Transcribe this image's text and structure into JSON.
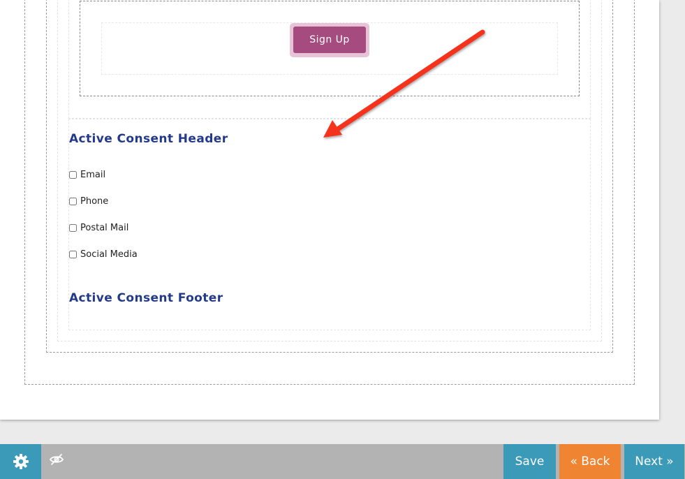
{
  "form": {
    "signup_label": "Sign Up"
  },
  "consent": {
    "header": "Active Consent Header",
    "footer": "Active Consent Footer",
    "options": [
      {
        "label": "Email",
        "checked": false
      },
      {
        "label": "Phone",
        "checked": false
      },
      {
        "label": "Postal Mail",
        "checked": false
      },
      {
        "label": "Social Media",
        "checked": false
      }
    ]
  },
  "annotation": {
    "arrow_color": "#f5321e"
  },
  "toolbar": {
    "settings_icon": "gear-icon",
    "visibility_icon": "eye-slash-icon",
    "save_label": "Save",
    "back_label": "« Back",
    "next_label": "Next »"
  },
  "colors": {
    "signup_button": "#a64b7f",
    "heading": "#233a8a",
    "toolbar_blue": "#3a9ab8",
    "toolbar_orange": "#ef8433",
    "toolbar_bg": "#b3b3b3"
  }
}
